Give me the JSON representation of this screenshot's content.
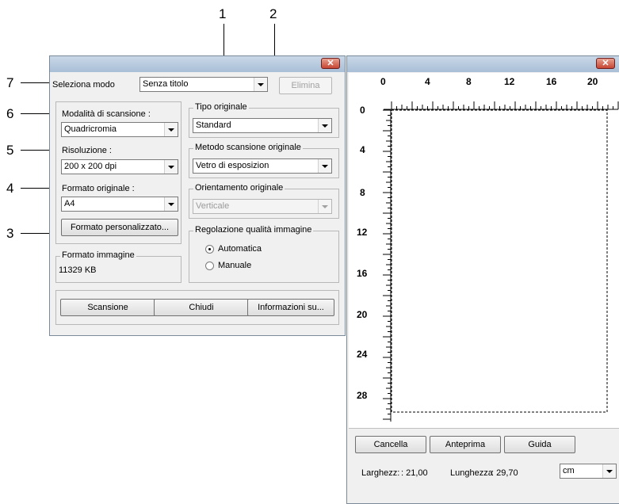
{
  "callouts": [
    "1",
    "2",
    "3",
    "4",
    "5",
    "6",
    "7"
  ],
  "main_window": {
    "close_glyph": "✕",
    "mode_label": "Seleziona modo",
    "mode_value": "Senza titolo",
    "delete_button": "Elimina",
    "scan_mode": {
      "label": "Modalità di scansione :",
      "value": "Quadricromia"
    },
    "resolution": {
      "label": "Risoluzione :",
      "value": "200 x 200 dpi"
    },
    "original_format": {
      "label": "Formato originale :",
      "value": "A4"
    },
    "custom_format_button": "Formato personalizzato...",
    "image_format": {
      "label": "Formato immagine",
      "value": "11329 KB"
    },
    "original_type": {
      "label": "Tipo originale",
      "value": "Standard"
    },
    "scan_method": {
      "label": "Metodo scansione originale",
      "value": "Vetro di esposizion"
    },
    "orientation": {
      "label": "Orientamento originale",
      "value": "Verticale"
    },
    "quality": {
      "label": "Regolazione qualità immagine",
      "automatic": "Automatica",
      "manual": "Manuale",
      "selected": "Automatica"
    },
    "buttons": {
      "scan": "Scansione",
      "close": "Chiudi",
      "info": "Informazioni su..."
    }
  },
  "preview_window": {
    "close_glyph": "✕",
    "ruler_top": [
      "0",
      "4",
      "8",
      "12",
      "16",
      "20"
    ],
    "ruler_left": [
      "0",
      "4",
      "8",
      "12",
      "16",
      "20",
      "24",
      "28"
    ],
    "buttons": {
      "clear": "Cancella",
      "preview": "Anteprima",
      "guide": "Guida"
    },
    "width_label": "Larghezz:",
    "width_value": ": 21,00",
    "length_label": "Lunghezza",
    "length_value": ": 29,70",
    "unit": "cm"
  },
  "colors": {
    "titlebar": "#b5c8dc",
    "close_button": "#c64632",
    "scan_area_border": "#000000",
    "dialog_bg": "#f0f0f0"
  }
}
